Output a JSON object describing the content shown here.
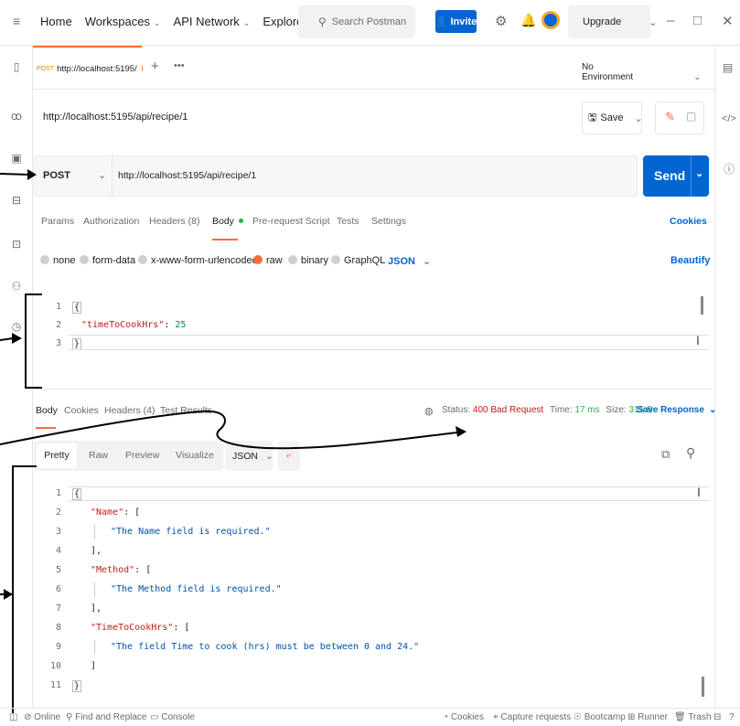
{
  "topbar": {
    "menu_icon": "hamburger-icon",
    "nav": [
      "Home",
      "Workspaces",
      "API Network",
      "Explore"
    ],
    "search_placeholder": "Search Postman",
    "invite_label": "Invite",
    "upgrade_label": "Upgrade"
  },
  "tab": {
    "method": "POST",
    "url": "http://localhost:5195/",
    "environment": "No Environment"
  },
  "request": {
    "title": "http://localhost:5195/api/recipe/1",
    "save_label": "Save",
    "method": "POST",
    "url": "http://localhost:5195/api/recipe/1",
    "send_label": "Send",
    "tabs": [
      "Params",
      "Authorization",
      "Headers (8)",
      "Body",
      "Pre-request Script",
      "Tests",
      "Settings"
    ],
    "cookies_link": "Cookies",
    "body_options": [
      "none",
      "form-data",
      "x-www-form-urlencoded",
      "raw",
      "binary",
      "GraphQL"
    ],
    "body_format": "JSON",
    "beautify_link": "Beautify",
    "editor_lines": [
      "1",
      "2",
      "3"
    ],
    "body_line1": "{",
    "body_key": "\"timeToCookHrs\"",
    "body_colon": ": ",
    "body_value": "25",
    "body_line3": "}"
  },
  "response": {
    "tabs": [
      "Body",
      "Cookies",
      "Headers (4)",
      "Test Results"
    ],
    "status_label": "Status:",
    "status_value": "400 Bad Request",
    "time_label": "Time:",
    "time_value": "17 ms",
    "size_label": "Size:",
    "size_value": "315 B",
    "save_response": "Save Response",
    "view_tabs": [
      "Pretty",
      "Raw",
      "Preview",
      "Visualize"
    ],
    "format": "JSON",
    "lines": [
      "1",
      "2",
      "3",
      "4",
      "5",
      "6",
      "7",
      "8",
      "9",
      "10",
      "11"
    ],
    "code": {
      "l1": "{",
      "l2_key": "\"Name\"",
      "l2_rest": ": [",
      "l3": "\"The Name field is required.\"",
      "l4": "],",
      "l5_key": "\"Method\"",
      "l5_rest": ": [",
      "l6": "\"The Method field is required.\"",
      "l7": "],",
      "l8_key": "\"TimeToCookHrs\"",
      "l8_rest": ": [",
      "l9": "\"The field Time to cook (hrs) must be between 0 and 24.\"",
      "l10": "]",
      "l11": "}"
    }
  },
  "footer": {
    "online": "Online",
    "find_replace": "Find and Replace",
    "console": "Console",
    "cookies": "Cookies",
    "capture": "Capture requests",
    "bootcamp": "Bootcamp",
    "runner": "Runner",
    "trash": "Trash"
  },
  "colors": {
    "accent": "#ff6c37",
    "primary": "#0265d2"
  }
}
